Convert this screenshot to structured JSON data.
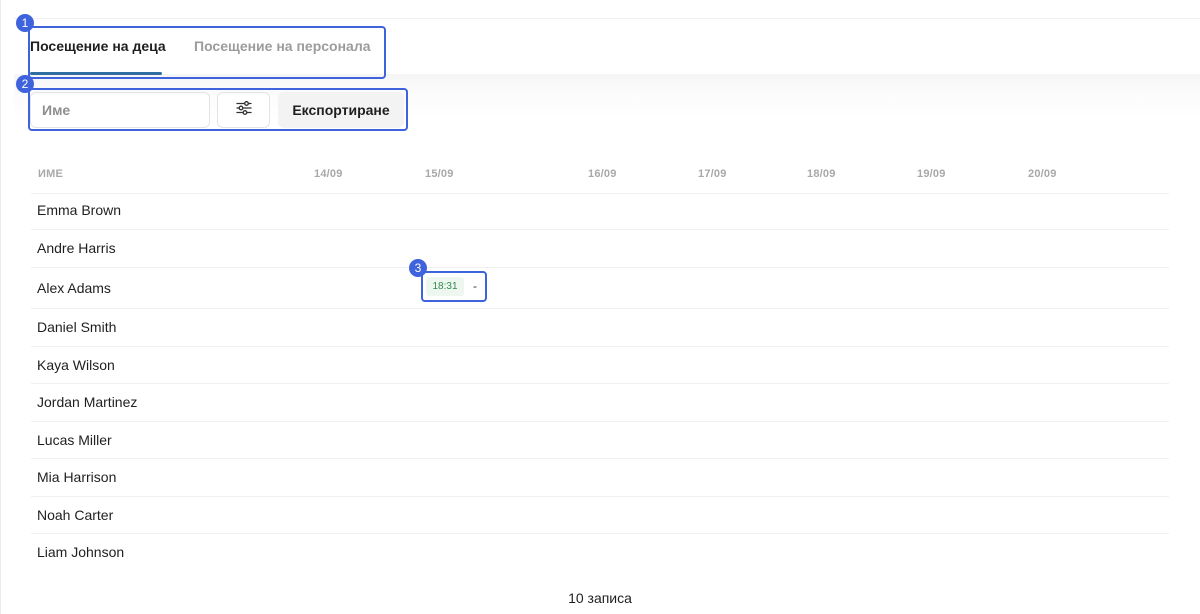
{
  "tabs": [
    {
      "label": "Посещение на деца",
      "active": true
    },
    {
      "label": "Посещение на персонала",
      "active": false
    }
  ],
  "toolbar": {
    "search_placeholder": "Име",
    "filter_icon": "sliders-icon",
    "export_label": "Експортиране"
  },
  "table": {
    "columns": [
      "ИМЕ",
      "14/09",
      "15/09",
      "16/09",
      "17/09",
      "18/09",
      "19/09",
      "20/09"
    ],
    "rows": [
      {
        "name": "Emma Brown"
      },
      {
        "name": "Andre Harris"
      },
      {
        "name": "Alex Adams",
        "entry": {
          "date": "15/09",
          "time": "18:31",
          "end": "-"
        }
      },
      {
        "name": "Daniel Smith"
      },
      {
        "name": "Kaya Wilson"
      },
      {
        "name": "Jordan Martinez"
      },
      {
        "name": "Lucas Miller"
      },
      {
        "name": "Mia Harrison"
      },
      {
        "name": "Noah Carter"
      },
      {
        "name": "Liam Johnson"
      }
    ]
  },
  "footer": {
    "count_label": "10 записа"
  },
  "annotations": [
    "1",
    "2",
    "3"
  ],
  "colors": {
    "accent": "#2f6ea3",
    "annotation": "#3e63dd",
    "time_chip_text": "#2e8a4f",
    "time_chip_bg": "#eef6f0"
  }
}
